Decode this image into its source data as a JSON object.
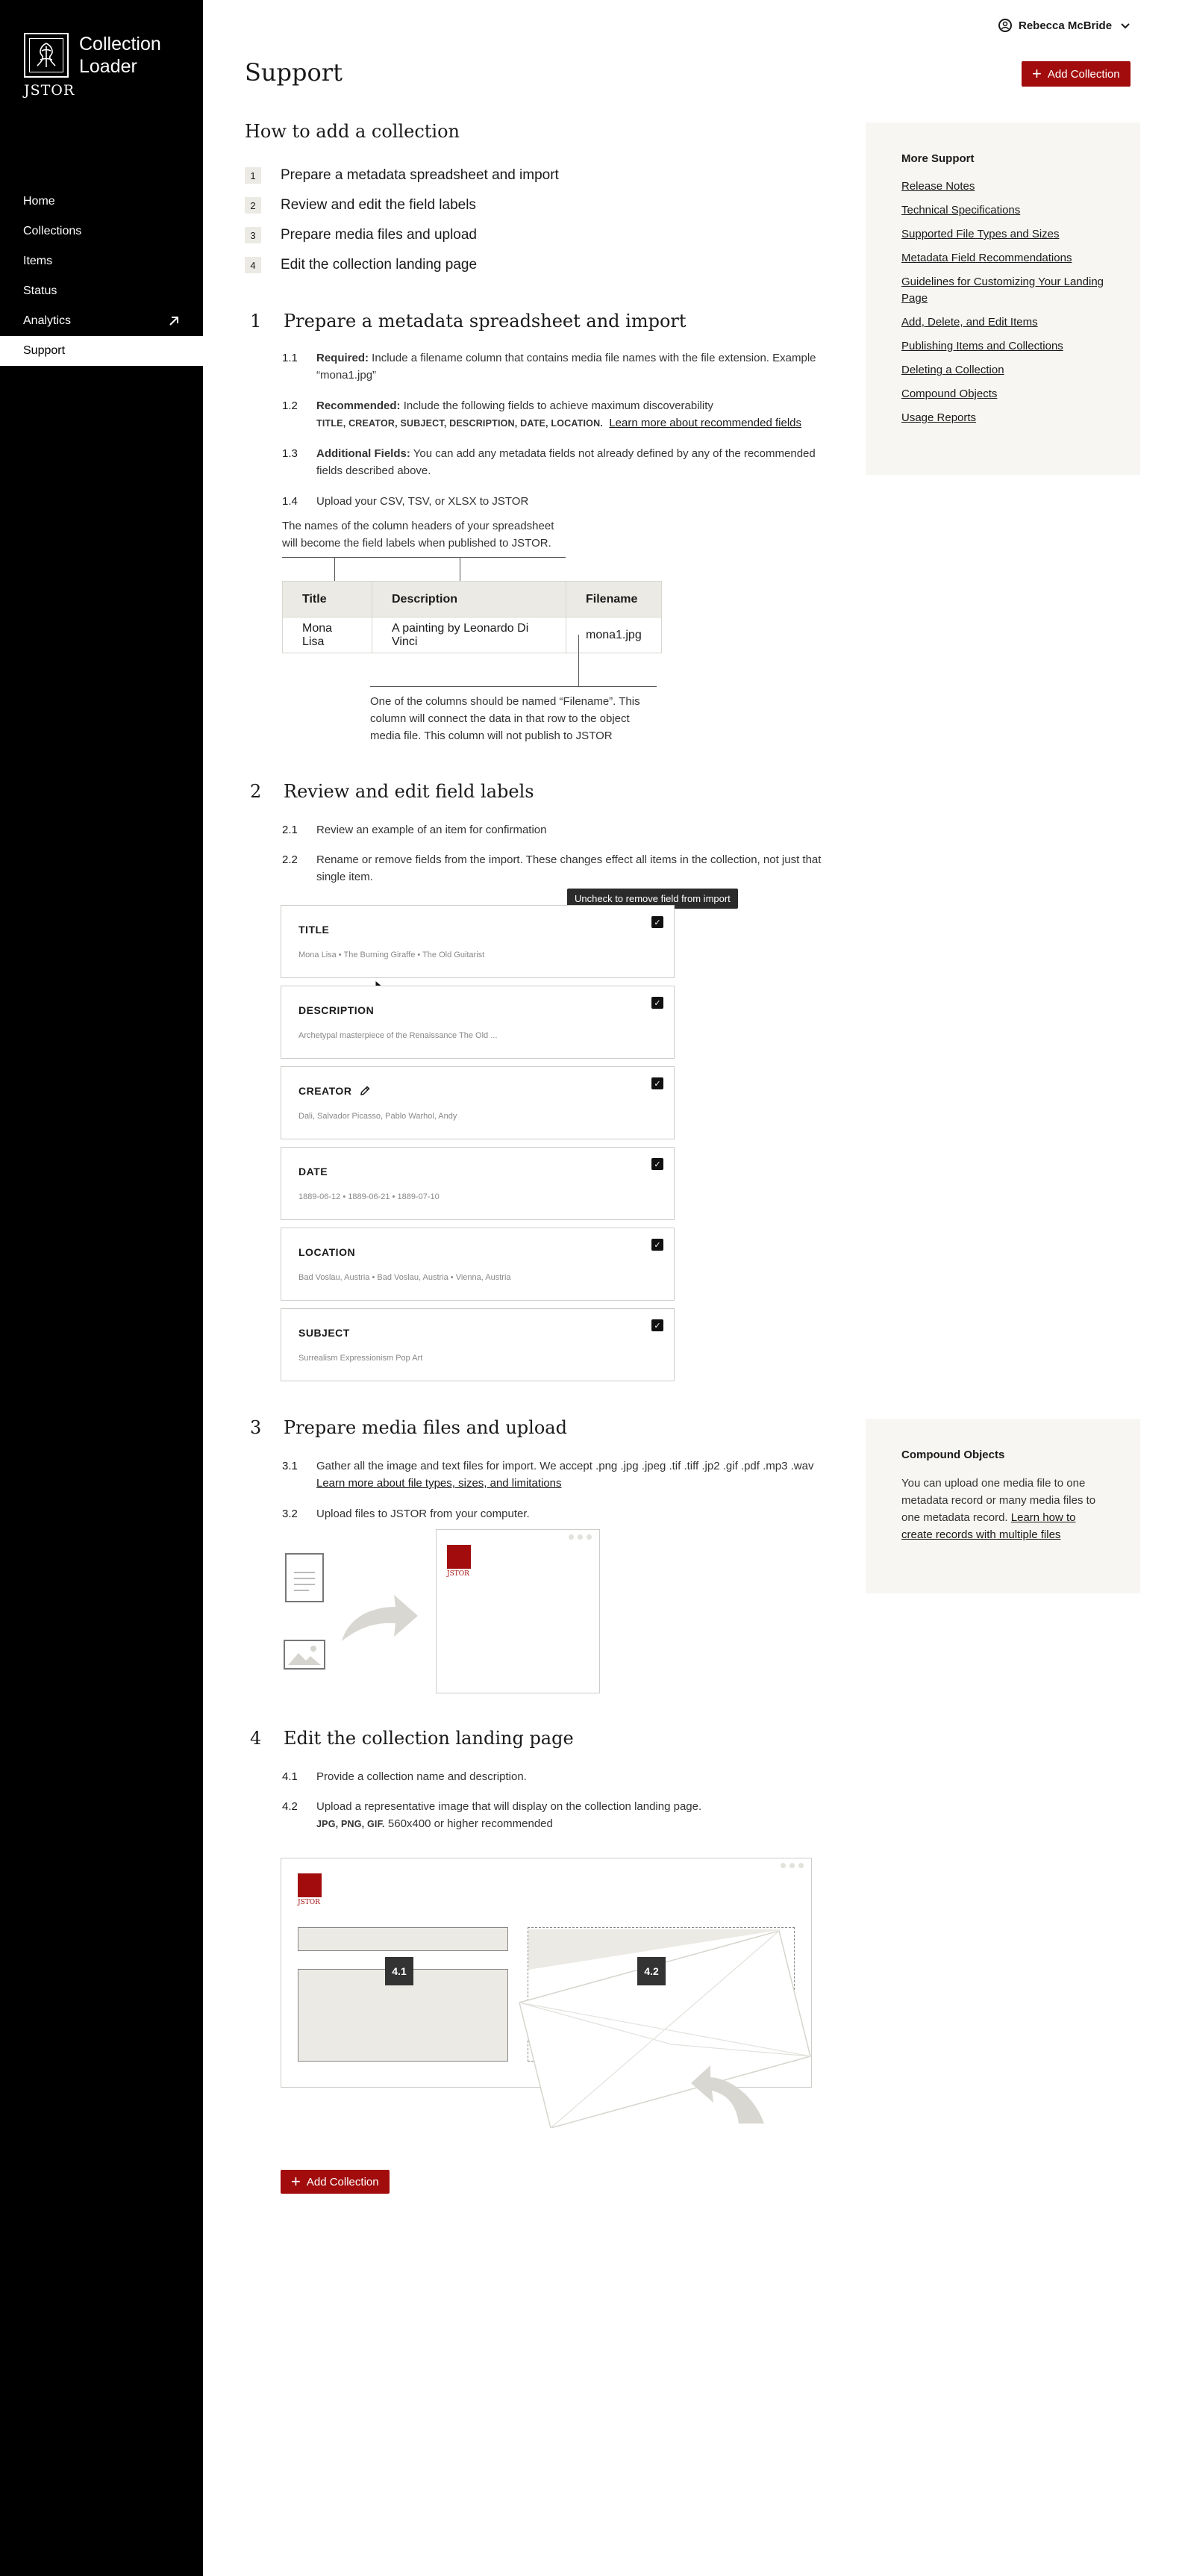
{
  "app": {
    "name_line1": "Collection",
    "name_line2": "Loader",
    "wordmark": "JSTOR"
  },
  "nav": [
    {
      "label": "Home"
    },
    {
      "label": "Collections"
    },
    {
      "label": "Items"
    },
    {
      "label": "Status"
    },
    {
      "label": "Analytics",
      "icon": "external-arrow-icon"
    },
    {
      "label": "Support",
      "active": true
    }
  ],
  "user": {
    "name": "Rebecca McBride"
  },
  "page": {
    "title": "Support",
    "add_label": "Add Collection"
  },
  "howto": {
    "title": "How to add a collection",
    "items": [
      {
        "num": "1",
        "label": "Prepare a metadata spreadsheet and import"
      },
      {
        "num": "2",
        "label": "Review and edit the field labels"
      },
      {
        "num": "3",
        "label": "Prepare media files and upload"
      },
      {
        "num": "4",
        "label": "Edit the collection landing page"
      }
    ]
  },
  "more_support": {
    "title": "More Support",
    "links": [
      "Release Notes",
      "Technical Specifications",
      "Supported File Types and Sizes",
      "Metadata Field Recommendations",
      "Guidelines for Customizing Your Landing Page",
      "Add, Delete, and Edit Items",
      "Publishing Items and Collections",
      "Deleting a Collection",
      "Compound Objects",
      "Usage Reports"
    ]
  },
  "s1": {
    "num": "1",
    "title": "Prepare a metadata spreadsheet and import",
    "steps": {
      "s11": {
        "num": "1.1",
        "bold": "Required:",
        "text": " Include a filename column that contains media file names with the file extension. Example “mona1.jpg”"
      },
      "s12": {
        "num": "1.2",
        "bold": "Recommended:",
        "text": " Include the following fields to achieve maximum discoverability",
        "caps": "TITLE, CREATOR, SUBJECT, DESCRIPTION, DATE, LOCATION.",
        "link": "Learn more about recommended fields"
      },
      "s13": {
        "num": "1.3",
        "bold": "Additional Fields:",
        "text": " You can add any metadata fields not already defined by any of the recommended fields described above."
      },
      "s14": {
        "num": "1.4",
        "text": "Upload your CSV, TSV, or XLSX to JSTOR"
      }
    },
    "note_headers": "The names of the column headers of your spreadsheet will become the field labels when published to JSTOR.",
    "table": {
      "headers": [
        "Title",
        "Description",
        "Filename"
      ],
      "row": [
        "Mona Lisa",
        "A painting by Leonardo Di Vinci",
        "mona1.jpg"
      ]
    },
    "note_filename": "One of the columns should be named “Filename”.  This column will connect the data in that row to the object media file. This column will not publish to JSTOR"
  },
  "s2": {
    "num": "2",
    "title": "Review and edit field labels",
    "steps": {
      "s21": {
        "num": "2.1",
        "text": "Review an example of an item for confirmation"
      },
      "s22": {
        "num": "2.2",
        "text": "Rename or remove fields from the import. These changes effect all items in the collection, not just that single item."
      }
    },
    "tooltip": "Uncheck to remove field from import",
    "fields": [
      {
        "label": "TITLE",
        "values": "Mona Lisa  • The Burning Giraffe  • The Old Guitarist",
        "checked": true
      },
      {
        "label": "DESCRIPTION",
        "values": "Archetypal masterpiece of the Renaissance     The Old ...",
        "checked": true
      },
      {
        "label": "CREATOR",
        "values": "Dali, Salvador     Picasso, Pablo     Warhol, Andy",
        "checked": true,
        "editable": true
      },
      {
        "label": "DATE",
        "values": "1889-06-12 • 1889-06-21 • 1889-07-10",
        "checked": true
      },
      {
        "label": "LOCATION",
        "values": "Bad Voslau, Austria • Bad Voslau, Austria • Vienna, Austria",
        "checked": true
      },
      {
        "label": "SUBJECT",
        "values": "Surrealism     Expressionism     Pop Art",
        "checked": true
      }
    ]
  },
  "s3": {
    "num": "3",
    "title": "Prepare media files and upload",
    "steps": {
      "s31": {
        "num": "3.1",
        "text": "Gather all the image and text files for import. We accept .png .jpg .jpeg .tif .tiff .jp2 .gif .pdf .mp3 .wav ",
        "link": "Learn more about file types, sizes, and limitations"
      },
      "s32": {
        "num": "3.2",
        "text": "Upload files to JSTOR from your computer."
      }
    },
    "mini_wordmark": "JSTOR"
  },
  "compound": {
    "title": "Compound Objects",
    "text": "You can upload one media file to one metadata record or many media files to one metadata record. ",
    "link": "Learn how to create records with multiple files"
  },
  "s4": {
    "num": "4",
    "title": "Edit the collection landing page",
    "steps": {
      "s41": {
        "num": "4.1",
        "text": "Provide a collection name and description."
      },
      "s42": {
        "num": "4.2",
        "text": "Upload a representative image that will display on the collection landing page.",
        "caps": "JPG, PNG, GIF.",
        "text2": " 560x400 or higher recommended"
      }
    },
    "badges": [
      "4.1",
      "4.2"
    ],
    "mini_wordmark": "JSTOR"
  },
  "bottom": {
    "add_label": "Add Collection"
  },
  "colors": {
    "accent": "#a20c0c",
    "sidebar": "#000000",
    "panel": "#f7f6f3"
  }
}
